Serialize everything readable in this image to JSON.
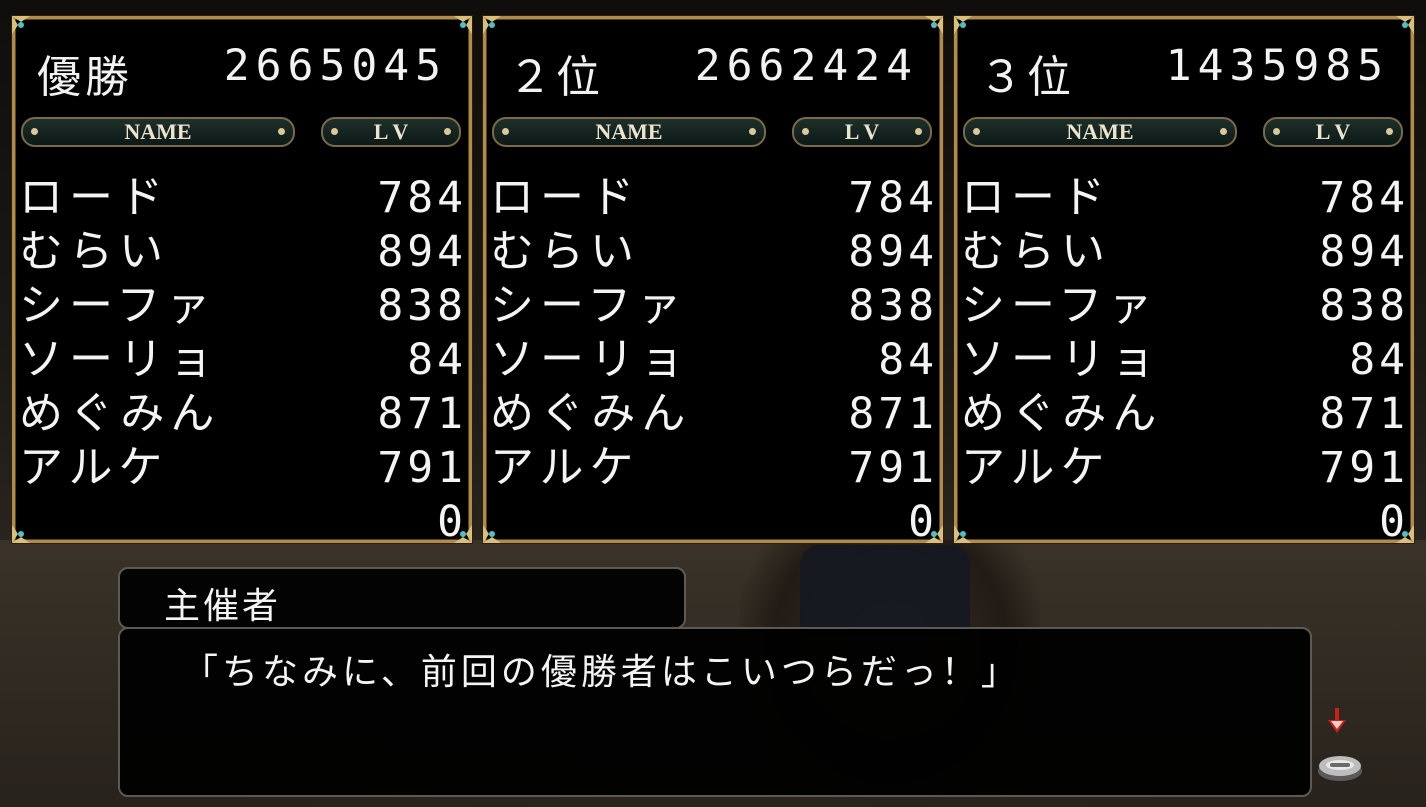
{
  "panels": [
    {
      "rank": "優勝",
      "score": "2665045",
      "header_name": "NAME",
      "header_lv": "L V",
      "members": [
        {
          "name": "ロード",
          "lv": "784"
        },
        {
          "name": "むらい",
          "lv": "894"
        },
        {
          "name": "シーファ",
          "lv": "838"
        },
        {
          "name": "ソーリョ",
          "lv": "84"
        },
        {
          "name": "めぐみん",
          "lv": "871"
        },
        {
          "name": "アルケ",
          "lv": "791"
        },
        {
          "name": "",
          "lv": "0"
        }
      ]
    },
    {
      "rank": "２位",
      "score": "2662424",
      "header_name": "NAME",
      "header_lv": "L V",
      "members": [
        {
          "name": "ロード",
          "lv": "784"
        },
        {
          "name": "むらい",
          "lv": "894"
        },
        {
          "name": "シーファ",
          "lv": "838"
        },
        {
          "name": "ソーリョ",
          "lv": "84"
        },
        {
          "name": "めぐみん",
          "lv": "871"
        },
        {
          "name": "アルケ",
          "lv": "791"
        },
        {
          "name": "",
          "lv": "0"
        }
      ]
    },
    {
      "rank": "３位",
      "score": "1435985",
      "header_name": "NAME",
      "header_lv": "L V",
      "members": [
        {
          "name": "ロード",
          "lv": "784"
        },
        {
          "name": "むらい",
          "lv": "894"
        },
        {
          "name": "シーファ",
          "lv": "838"
        },
        {
          "name": "ソーリョ",
          "lv": "84"
        },
        {
          "name": "めぐみん",
          "lv": "871"
        },
        {
          "name": "アルケ",
          "lv": "791"
        },
        {
          "name": "",
          "lv": "0"
        }
      ]
    }
  ],
  "dialog": {
    "speaker": "主催者",
    "text": "「ちなみに、前回の優勝者はこいつらだっ！」"
  },
  "icons": {
    "next": "red-down-arrow-icon",
    "advance": "advance-button-icon"
  },
  "colors": {
    "frame_gold": "#b08c4a",
    "header_bg": "#1e2f2a",
    "next_arrow": "#c8201c"
  }
}
